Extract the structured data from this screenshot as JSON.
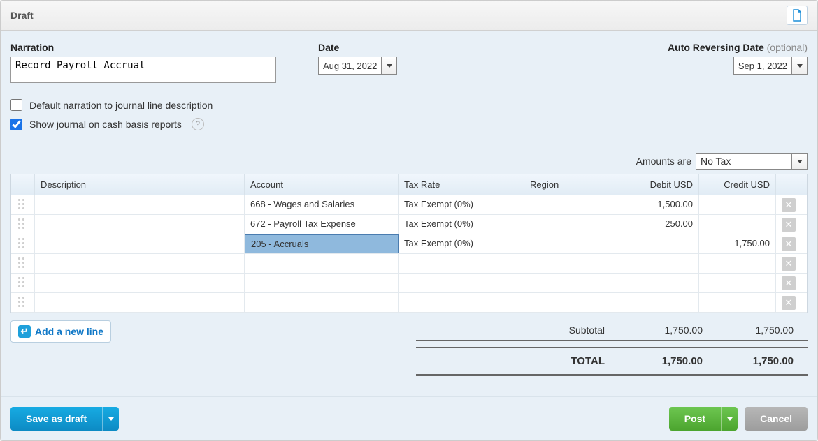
{
  "status": "Draft",
  "fields": {
    "narration_label": "Narration",
    "narration_value": "Record Payroll Accrual",
    "date_label": "Date",
    "date_value": "Aug 31, 2022",
    "auto_rev_label": "Auto Reversing Date",
    "auto_rev_optional": "(optional)",
    "auto_rev_value": "Sep 1, 2022"
  },
  "checkboxes": {
    "default_narration_label": "Default narration to journal line description",
    "default_narration_checked": false,
    "show_cash_label": "Show journal on cash basis reports",
    "show_cash_checked": true
  },
  "amounts": {
    "label": "Amounts are",
    "value": "No Tax"
  },
  "table": {
    "headers": {
      "description": "Description",
      "account": "Account",
      "tax_rate": "Tax Rate",
      "region": "Region",
      "debit": "Debit USD",
      "credit": "Credit USD"
    },
    "rows": [
      {
        "description": "",
        "account": "668 - Wages and Salaries",
        "tax_rate": "Tax Exempt (0%)",
        "region": "",
        "debit": "1,500.00",
        "credit": "",
        "selected": false
      },
      {
        "description": "",
        "account": "672 - Payroll Tax Expense",
        "tax_rate": "Tax Exempt (0%)",
        "region": "",
        "debit": "250.00",
        "credit": "",
        "selected": false
      },
      {
        "description": "",
        "account": "205 - Accruals",
        "tax_rate": "Tax Exempt (0%)",
        "region": "",
        "debit": "",
        "credit": "1,750.00",
        "selected": true
      },
      {
        "description": "",
        "account": "",
        "tax_rate": "",
        "region": "",
        "debit": "",
        "credit": "",
        "selected": false
      },
      {
        "description": "",
        "account": "",
        "tax_rate": "",
        "region": "",
        "debit": "",
        "credit": "",
        "selected": false
      },
      {
        "description": "",
        "account": "",
        "tax_rate": "",
        "region": "",
        "debit": "",
        "credit": "",
        "selected": false
      }
    ]
  },
  "add_line_label": "Add a new line",
  "totals": {
    "subtotal_label": "Subtotal",
    "subtotal_debit": "1,750.00",
    "subtotal_credit": "1,750.00",
    "total_label": "TOTAL",
    "total_debit": "1,750.00",
    "total_credit": "1,750.00"
  },
  "footer": {
    "save_draft": "Save as draft",
    "post": "Post",
    "cancel": "Cancel"
  },
  "chart_data": {
    "type": "table",
    "columns": [
      "Account",
      "Debit USD",
      "Credit USD"
    ],
    "rows": [
      [
        "668 - Wages and Salaries",
        1500.0,
        null
      ],
      [
        "672 - Payroll Tax Expense",
        250.0,
        null
      ],
      [
        "205 - Accruals",
        null,
        1750.0
      ]
    ],
    "subtotal": {
      "debit": 1750.0,
      "credit": 1750.0
    },
    "total": {
      "debit": 1750.0,
      "credit": 1750.0
    }
  }
}
